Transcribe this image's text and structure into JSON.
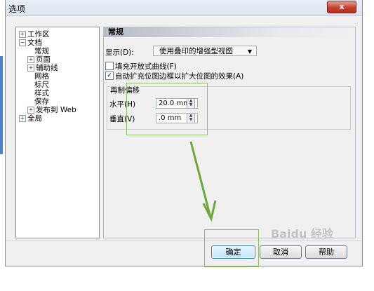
{
  "window": {
    "title": "选项",
    "close_glyph": "x"
  },
  "tree": [
    {
      "label": "工作区",
      "expander": "+"
    },
    {
      "label": "文档",
      "expander": "−"
    },
    {
      "label": "常规"
    },
    {
      "label": "页面",
      "expander": "+"
    },
    {
      "label": "辅助线",
      "expander": "+"
    },
    {
      "label": "网格"
    },
    {
      "label": "标尺"
    },
    {
      "label": "样式"
    },
    {
      "label": "保存"
    },
    {
      "label": "发布到 Web",
      "expander": "+"
    },
    {
      "label": "全局",
      "expander": "+"
    }
  ],
  "panel": {
    "header": "常规",
    "display_label": "显示(D):",
    "display_value": "使用叠印的增强型视图",
    "checkbox_fill_open": {
      "label": "填充开放式曲线(F)",
      "checked": false
    },
    "checkbox_auto_extend": {
      "label": "自动扩充位图边框以扩大位图的效果(A)",
      "checked": true,
      "mark": "✓"
    },
    "offset_group": {
      "title": "再制偏移",
      "horizontal_label": "水平(H)",
      "horizontal_value": "20.0 mm",
      "vertical_label": "垂直(V)",
      "vertical_value": ".0 mm"
    }
  },
  "buttons": {
    "ok": "确定",
    "cancel": "取消",
    "help": "帮助"
  },
  "watermark": "Baidu 经验",
  "colors": {
    "annotation_green": "#8dc060",
    "arrow_green": "#6aa83a",
    "close_red": "#c8402e"
  }
}
